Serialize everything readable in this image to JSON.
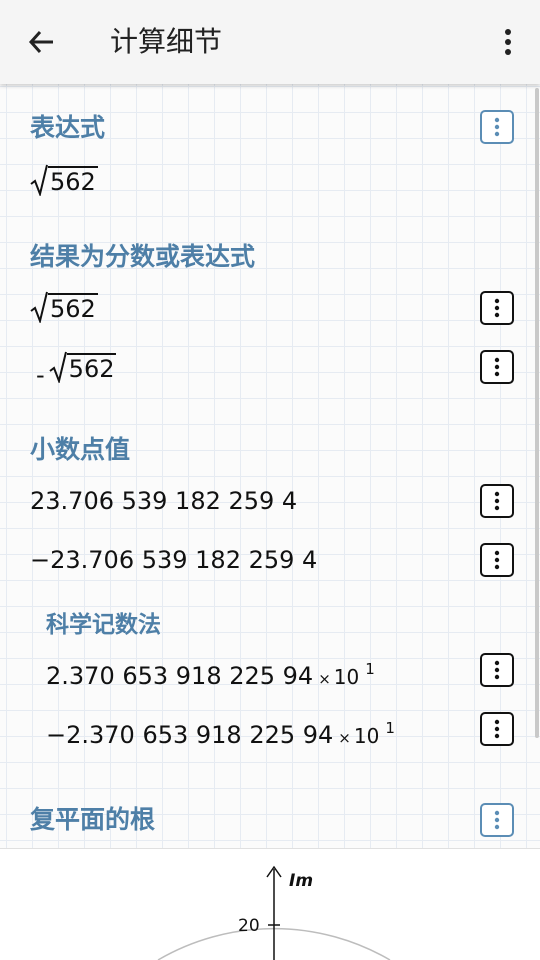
{
  "appbar": {
    "title": "计算细节",
    "back_icon": "arrow-left-icon",
    "overflow_icon": "more-vertical-icon"
  },
  "expression": {
    "heading": "表达式",
    "radicand": "562"
  },
  "fraction_results": {
    "heading": "结果为分数或表达式",
    "rows": [
      {
        "sign": "",
        "radicand": "562"
      },
      {
        "sign": "-",
        "radicand": "562"
      }
    ]
  },
  "decimal": {
    "heading": "小数点值",
    "rows": [
      "23.706 539 182 259 4",
      "−23.706 539 182 259 4"
    ]
  },
  "scientific": {
    "heading": "科学记数法",
    "times": "×",
    "base": "10",
    "rows": [
      {
        "mantissa": "2.370 653 918 225 94",
        "exponent": "1"
      },
      {
        "mantissa": "−2.370 653 918 225 94",
        "exponent": "1"
      }
    ]
  },
  "complex_roots": {
    "heading": "复平面的根",
    "axis_label": "Im",
    "tick_label": "20"
  },
  "colors": {
    "heading": "#4e7fa7",
    "button_blue": "#5b8db5",
    "grid": "#e6ebf2"
  }
}
